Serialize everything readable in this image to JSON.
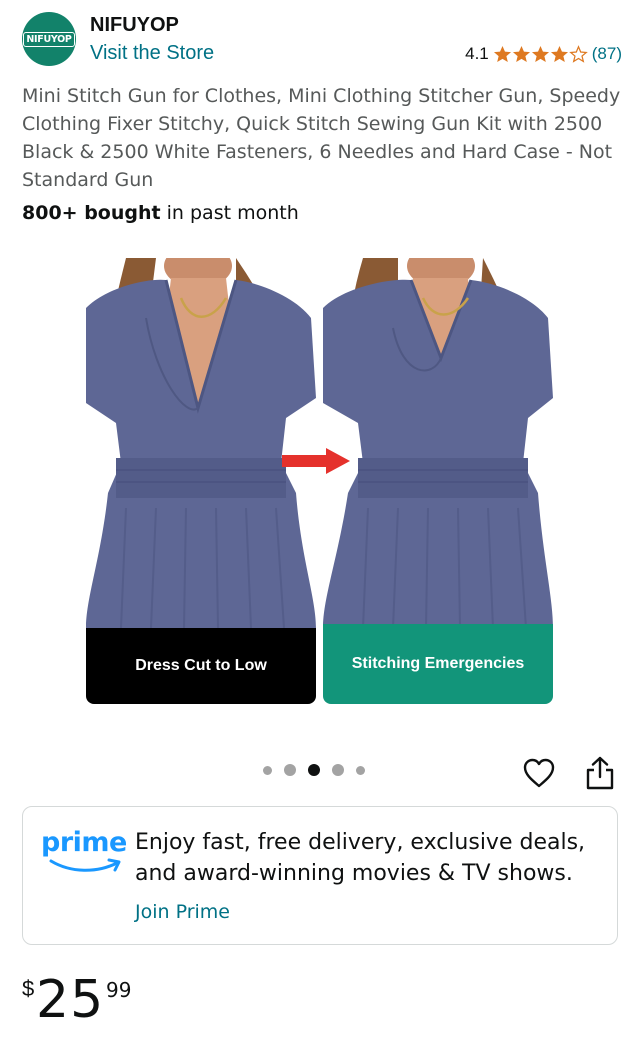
{
  "store": {
    "logo_text": "NIFUYOP",
    "brand_name": "NIFUYOP",
    "visit_link": "Visit the Store",
    "rating_value": "4.1",
    "rating_stars": 4.1,
    "rating_count": "(87)"
  },
  "product": {
    "title": "Mini Stitch Gun for Clothes, Mini Clothing Stitcher Gun, Speedy Clothing Fixer Stitchy, Quick Stitch Sewing Gun Kit with 2500 Black & 2500 White Fasteners, 6 Needles and Hard Case - Not Standard Gun",
    "bought_bold": "800+ bought",
    "bought_rest": " in past month"
  },
  "gallery": {
    "captions": [
      "Dress Cut to Low",
      "Stitching Emergencies"
    ],
    "dots_total": 5,
    "active_dot": 3,
    "colors": {
      "dress": "#5e6795",
      "caption_left": "#000000",
      "caption_right": "#12957a",
      "arrow": "#e5312c"
    }
  },
  "prime": {
    "logo_word": "prime",
    "description": "Enjoy fast, free delivery, exclusive deals, and award-winning movies & TV shows.",
    "join_link": "Join Prime"
  },
  "price": {
    "symbol": "$",
    "whole": "25",
    "fraction": "99"
  },
  "colors": {
    "link": "#007185",
    "star": "#de7921",
    "prime_blue": "#1a98ff",
    "brand_green": "#12826a"
  },
  "icons": [
    "heart-icon",
    "share-icon",
    "star-icon",
    "prime-smile-icon",
    "right-arrow-icon"
  ]
}
